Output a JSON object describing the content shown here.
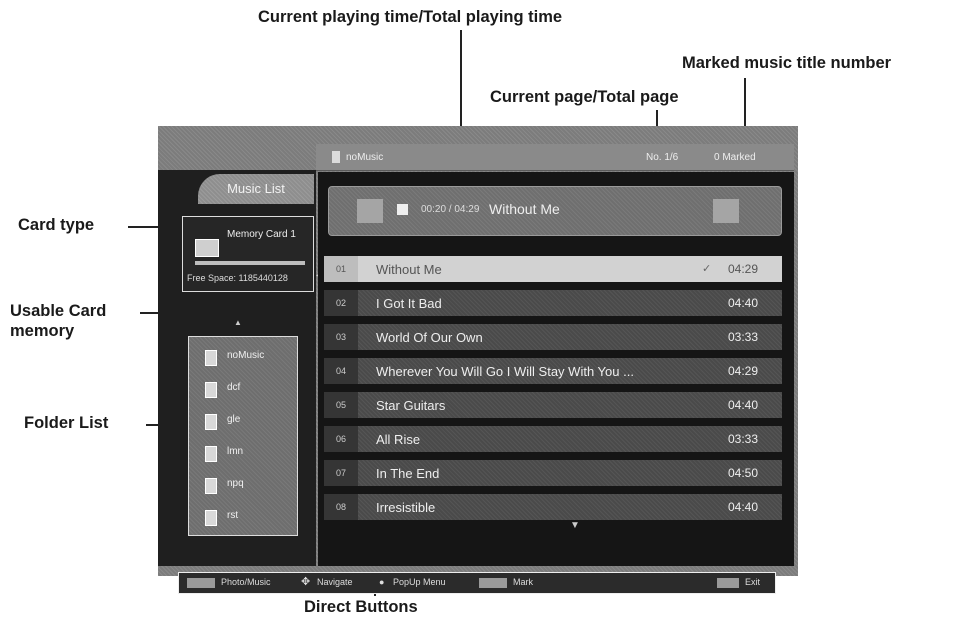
{
  "callouts": {
    "current_time": "Current playing time/Total playing time",
    "marked": "Marked music title number",
    "current_page": "Current page/Total page",
    "card_type": "Card type",
    "usable_memory_1": "Usable Card",
    "usable_memory_2": "memory",
    "folder_list": "Folder List",
    "direct_buttons": "Direct Buttons"
  },
  "screen": {
    "tab_title": "Music List",
    "top_bar": {
      "folder_name": "noMusic",
      "page": "No. 1/6",
      "marked": "0 Marked"
    },
    "card": {
      "name": "Memory Card 1",
      "free_space": "Free Space: 1185440128"
    },
    "folders": [
      "noMusic",
      "dcf",
      "gle",
      "lmn",
      "npq",
      "rst"
    ],
    "playing": {
      "time": "00:20 / 04:29",
      "title": "Without Me"
    },
    "tracks": [
      {
        "num": "01",
        "title": "Without Me",
        "mark": "✓",
        "time": "04:29",
        "selected": true
      },
      {
        "num": "02",
        "title": "I Got It Bad",
        "time": "04:40"
      },
      {
        "num": "03",
        "title": "World Of Our Own",
        "time": "03:33"
      },
      {
        "num": "04",
        "title": "Wherever You Will Go I Will Stay With You ...",
        "time": "04:29"
      },
      {
        "num": "05",
        "title": "Star Guitars",
        "time": "04:40"
      },
      {
        "num": "06",
        "title": "All Rise",
        "time": "03:33"
      },
      {
        "num": "07",
        "title": "In The End",
        "time": "04:50"
      },
      {
        "num": "08",
        "title": "Irresistible",
        "time": "04:40"
      }
    ],
    "bottom_bar": {
      "photo_music": "Photo/Music",
      "navigate": "Navigate",
      "popup": "PopUp Menu",
      "mark": "Mark",
      "exit": "Exit"
    }
  }
}
